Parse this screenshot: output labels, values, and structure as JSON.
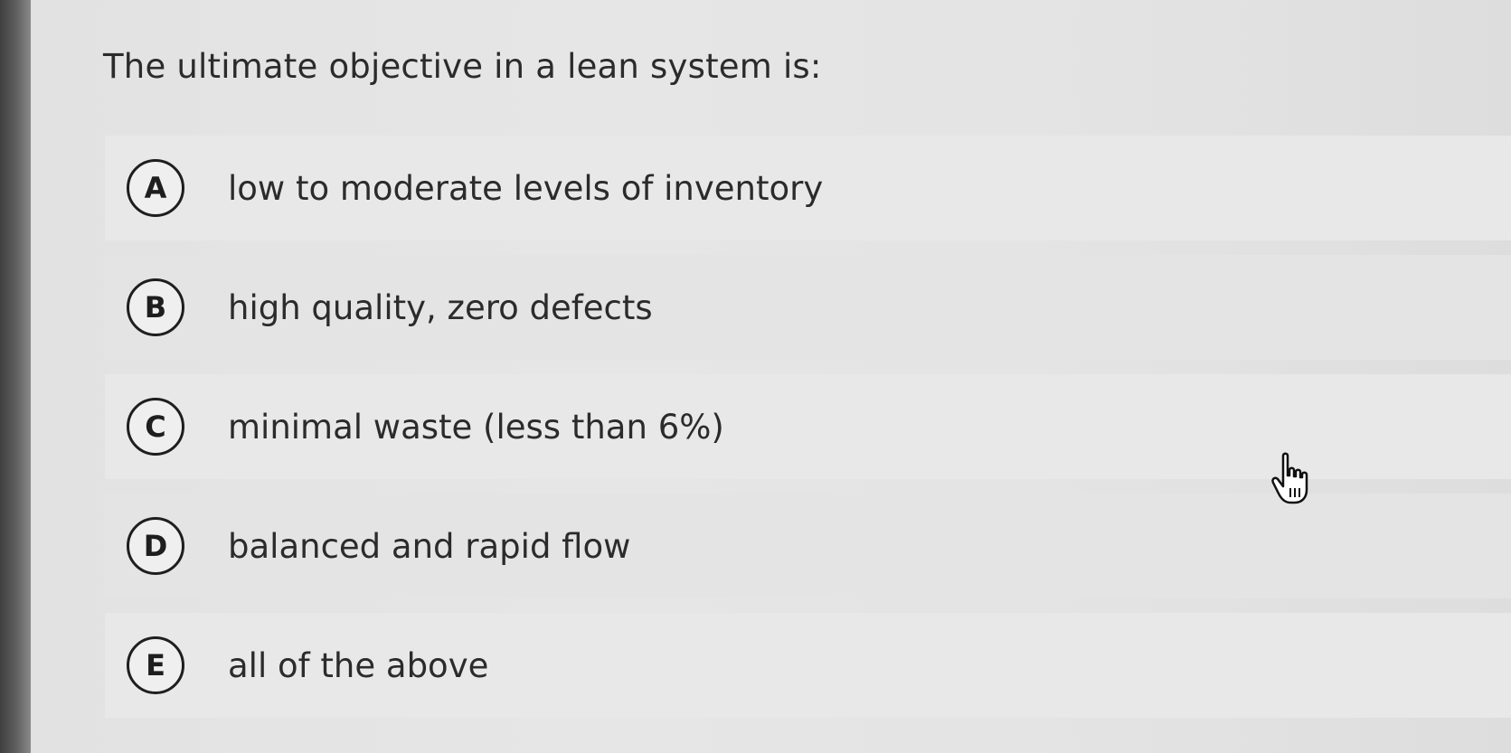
{
  "question": {
    "text": "The ultimate objective in a lean system is:"
  },
  "options": [
    {
      "letter": "A",
      "text": "low to moderate levels of inventory"
    },
    {
      "letter": "B",
      "text": "high quality, zero defects"
    },
    {
      "letter": "C",
      "text": "minimal waste (less than 6%)"
    },
    {
      "letter": "D",
      "text": "balanced and rapid flow"
    },
    {
      "letter": "E",
      "text": "all of the above"
    }
  ],
  "cursor": {
    "icon": "hand-pointer-icon"
  }
}
